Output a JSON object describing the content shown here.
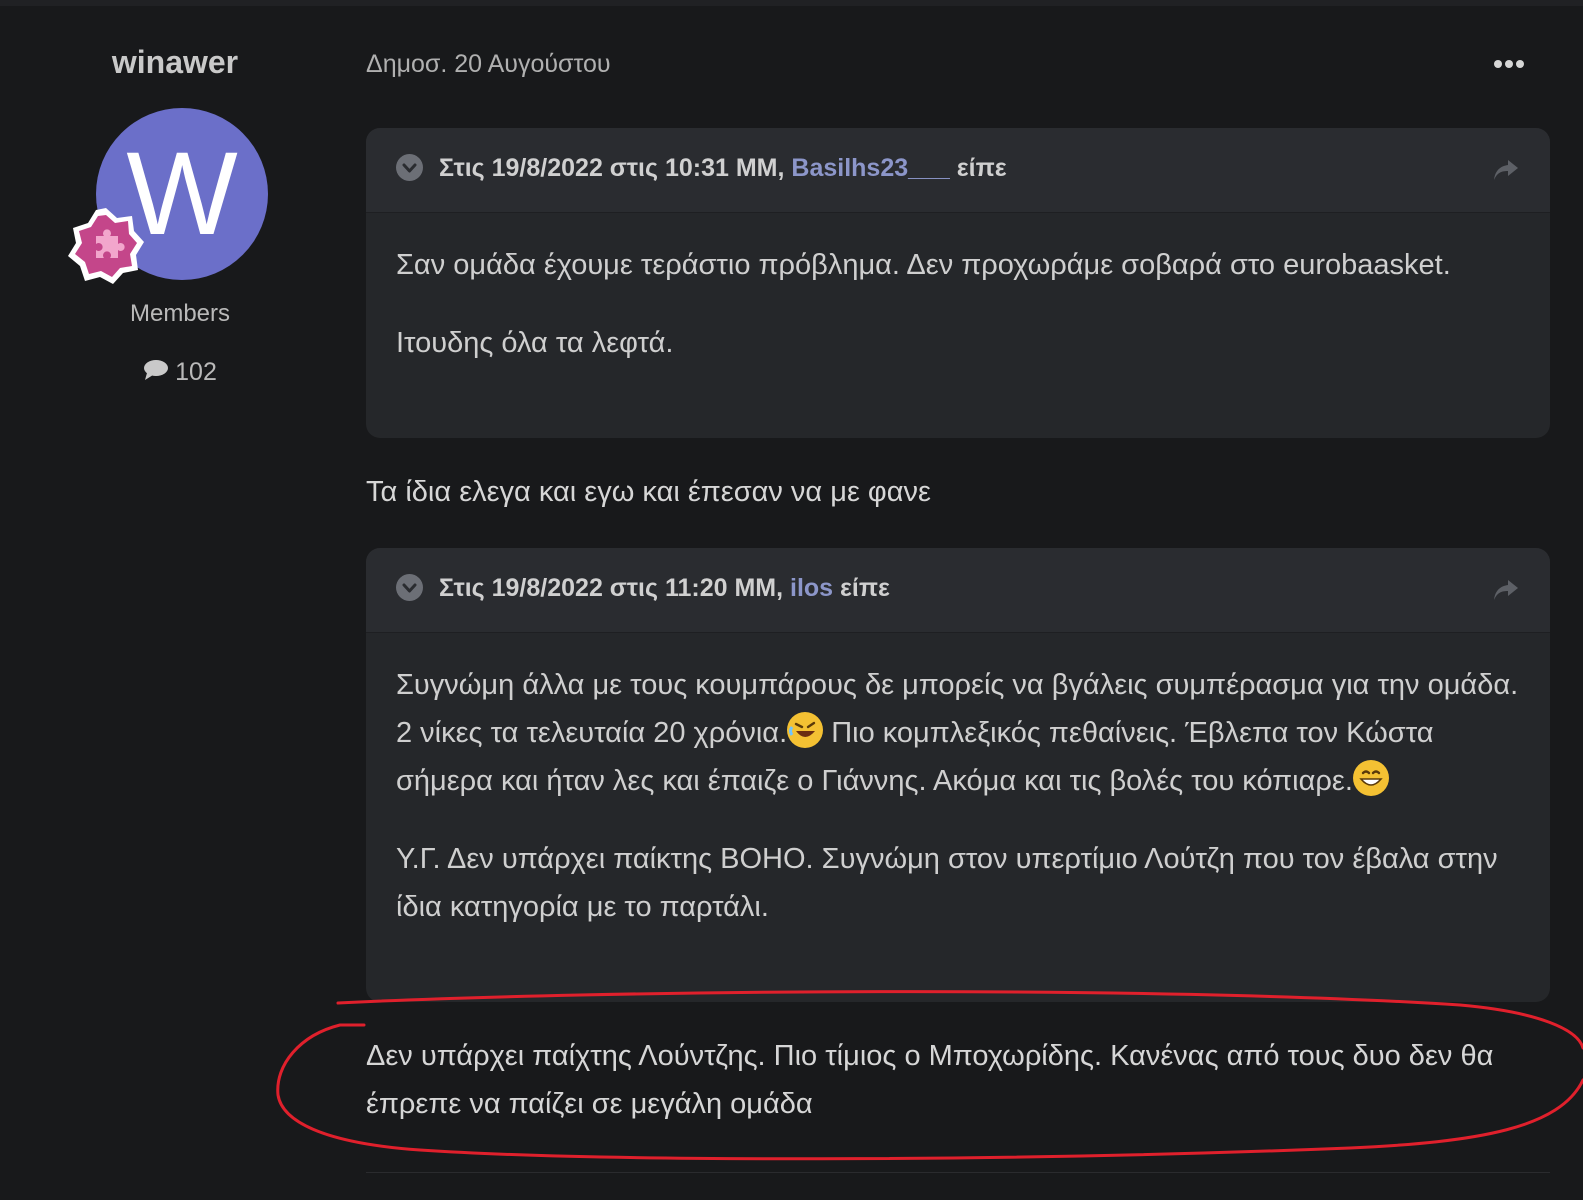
{
  "author": {
    "name": "winawer",
    "avatar_letter": "W",
    "rank": "Members",
    "post_count": "102",
    "avatar_color": "#6b6fc9",
    "badge_icon": "puzzle-badge-icon"
  },
  "post": {
    "date": "Δημοσ. 20 Αυγούστου",
    "menu_icon": "ellipsis-icon"
  },
  "quotes": [
    {
      "prefix": "Στις 19/8/2022 στις 10:31 ΜΜ,",
      "user": "Basilhs23___",
      "suffix": "είπε",
      "paragraphs": [
        "Σαν ομάδα έχουμε τεράστιο πρόβλημα. Δεν προχωράμε σοβαρά στο eurobaasket.",
        "Ιτουδης όλα τα λεφτά."
      ]
    },
    {
      "prefix": "Στις 19/8/2022 στις 11:20 ΜΜ,",
      "user": "ilos",
      "suffix": "είπε",
      "p1_a": "Συγνώμη άλλα με τους κουμπάρους δε μπορείς να βγάλεις συμπέρασμα για την ομάδα. 2 νίκες τα τελευταία 20 χρόνια.",
      "p1_b": " Πιο κομπλεξικός πεθαίνεις. Έβλεπα τον Κώστα σήμερα και ήταν λες και έπαιζε ο Γιάννης. Ακόμα και τις βολές του κόπιαρε.",
      "p2": "Υ.Γ. Δεν υπάρχει παίκτης ΒΟΗΟ. Συγνώμη στον υπερτίμιο Λούτζη που τον έβαλα στην ίδια κατηγορία με το παρτάλι."
    }
  ],
  "replies": {
    "first": "Τα ίδια ελεγα και εγω και έπεσαν να με φανε",
    "second": "Δεν υπάρχει παίχτης Λούντζης. Πιο τίμιος ο Μποχωρίδης. Κανένας από τους δυο δεν θα έπρεπε να παίζει σε μεγάλη ομάδα"
  },
  "colors": {
    "background": "#18191b",
    "quote_background": "#25272a",
    "username_link": "#8c96c9",
    "annotation_red": "#e0202c"
  }
}
